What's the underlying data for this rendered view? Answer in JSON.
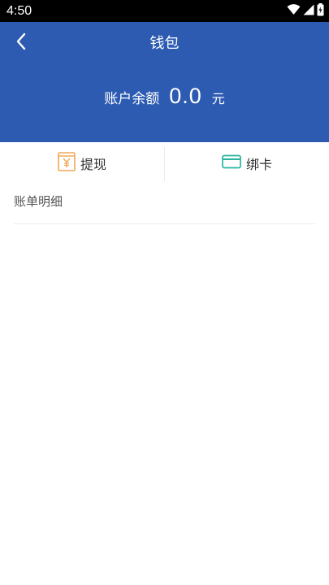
{
  "status_bar": {
    "time": "4:50",
    "icons": [
      "wifi-icon",
      "signal-icon",
      "battery-icon"
    ]
  },
  "header": {
    "title": "钱包",
    "back_icon": "chevron-left-icon",
    "balance_label": "账户余额",
    "balance_value": "0.0",
    "balance_unit": "元",
    "background_color": "#2d5bb2"
  },
  "actions": [
    {
      "label": "提现",
      "icon": "withdraw-icon",
      "icon_color": "#f0a855"
    },
    {
      "label": "绑卡",
      "icon": "bank-card-icon",
      "icon_color": "#2bb5a0"
    }
  ],
  "bill": {
    "title": "账单明细",
    "items": []
  }
}
